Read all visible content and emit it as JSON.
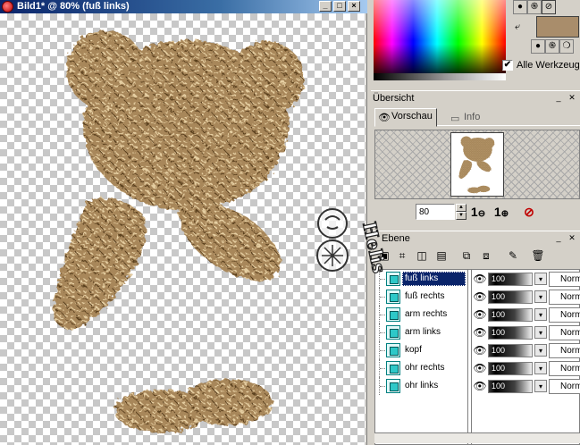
{
  "document": {
    "title": "Bild1* @ 80% (fuß links)",
    "caption_buttons": [
      "_",
      "□",
      "×"
    ]
  },
  "palette": {
    "foreground_color": "#a98d6b",
    "background_color": "#a98d6b",
    "swap_icon": "swap-arrows-icon",
    "all_tools_label": "Alle Werkzeuge",
    "all_tools_checked": "✔"
  },
  "overview": {
    "title": "Übersicht",
    "tabs": [
      {
        "label": "Vorschau",
        "icon": "eye-icon",
        "active": true
      },
      {
        "label": "Info",
        "icon": "info-icon",
        "active": false
      }
    ],
    "zoom_value": "80",
    "zoom_in_label": "1",
    "zoom_out_label": "1"
  },
  "layers": {
    "title": "Ebene",
    "items": [
      {
        "name": "fuß links",
        "opacity": "100",
        "blend": "Normal",
        "selected": true
      },
      {
        "name": "fuß rechts",
        "opacity": "100",
        "blend": "Normal",
        "selected": false
      },
      {
        "name": "arm rechts",
        "opacity": "100",
        "blend": "Normal",
        "selected": false
      },
      {
        "name": "arm links",
        "opacity": "100",
        "blend": "Normal",
        "selected": false
      },
      {
        "name": "kopf",
        "opacity": "100",
        "blend": "Normal",
        "selected": false
      },
      {
        "name": "ohr rechts",
        "opacity": "100",
        "blend": "Normal",
        "selected": false
      },
      {
        "name": "ohr links",
        "opacity": "100",
        "blend": "Normal",
        "selected": false
      }
    ]
  },
  "watermark": {
    "text": "Helis"
  },
  "colors": {
    "titlebar": "#0a246a",
    "fur": "#a98a5e",
    "selection": "#0a246a"
  }
}
